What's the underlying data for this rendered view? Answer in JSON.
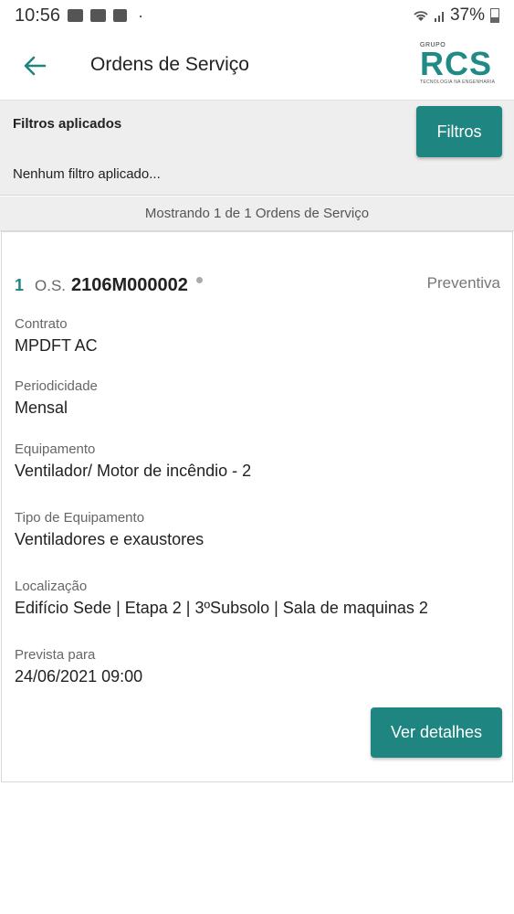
{
  "status_bar": {
    "time": "10:56",
    "battery": "37%",
    "icons": [
      "gallery-icon",
      "voicemail-icon",
      "teams-icon",
      "wifi-icon",
      "signal-icon",
      "battery-icon"
    ]
  },
  "app_bar": {
    "title": "Ordens de Serviço",
    "back_icon": "arrow-left-icon",
    "logo": {
      "top": "GRUPO",
      "main": "RCS",
      "sub": "TECNOLOGIA NA ENGENHARIA"
    }
  },
  "filters": {
    "label": "Filtros aplicados",
    "status": "Nenhum filtro aplicado...",
    "button": "Filtros"
  },
  "results": {
    "text": "Mostrando 1 de 1 Ordens de Serviço"
  },
  "order": {
    "index": "1",
    "prefix": "O.S.",
    "number": "2106M000002",
    "type": "Preventiva",
    "fields": [
      {
        "label": "Contrato",
        "value": "MPDFT AC"
      },
      {
        "label": "Periodicidade",
        "value": "Mensal"
      },
      {
        "label": "Equipamento",
        "value": "Ventilador/ Motor de incêndio - 2"
      },
      {
        "label": "Tipo de Equipamento",
        "value": "Ventiladores e exaustores"
      },
      {
        "label": "Localização",
        "value": "Edifício Sede | Etapa 2 | 3ºSubsolo | Sala de maquinas 2"
      },
      {
        "label": "Prevista para",
        "value": "24/06/2021 09:00"
      }
    ],
    "details_button": "Ver detalhes"
  },
  "colors": {
    "accent": "#1f8580",
    "filters_bg": "#eeeeee"
  }
}
